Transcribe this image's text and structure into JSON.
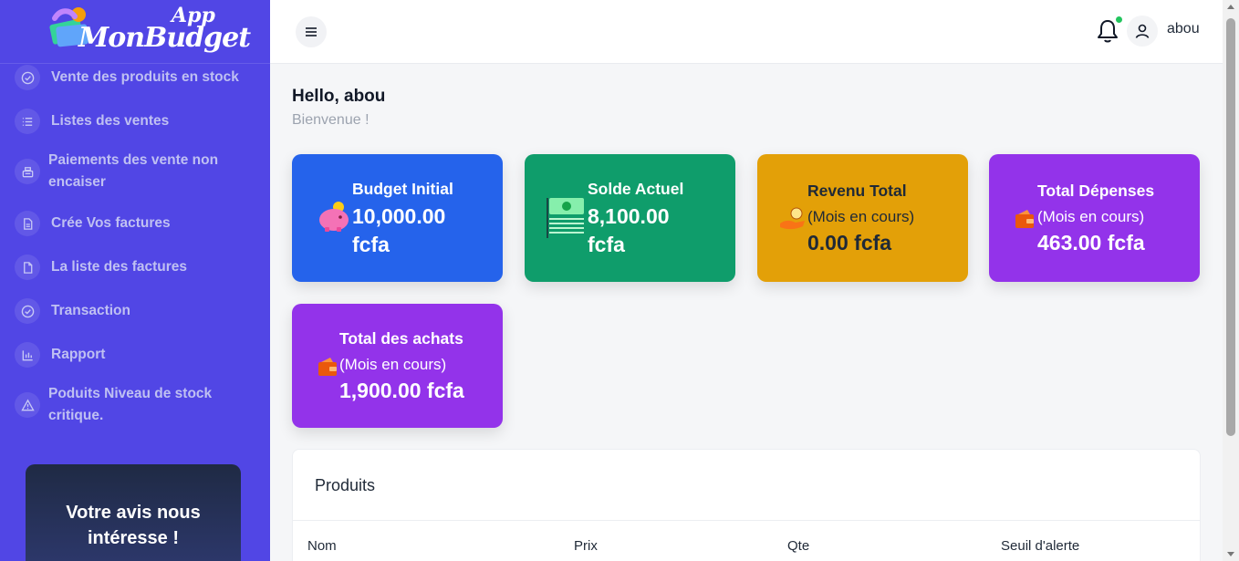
{
  "sidebar": {
    "logo": {
      "app": "App",
      "name": "MonBudget"
    },
    "items": [
      {
        "label": "Vente des produits en stock",
        "icon": "check-circle-icon"
      },
      {
        "label": "Listes des ventes",
        "icon": "list-icon"
      },
      {
        "label": "Paiements des vente non encaiser",
        "icon": "cash-register-icon"
      },
      {
        "label": "Crée Vos factures",
        "icon": "file-text-icon"
      },
      {
        "label": "La liste des factures",
        "icon": "file-icon"
      },
      {
        "label": "Transaction",
        "icon": "check-circle-icon"
      },
      {
        "label": "Rapport",
        "icon": "bar-chart-icon"
      },
      {
        "label": "Poduits Niveau de stock critique.",
        "icon": "warning-icon"
      }
    ],
    "feedback": {
      "line1": "Votre avis nous",
      "line2": "intéresse !"
    }
  },
  "header": {
    "user": "abou"
  },
  "main": {
    "greeting": "Hello, abou",
    "welcome": "Bienvenue !",
    "cards": [
      {
        "title": "Budget Initial",
        "value_line1": "10,000.00",
        "value_line2": "fcfa",
        "icon": "piggy-bank-icon",
        "color": "#2563eb"
      },
      {
        "title": "Solde Actuel",
        "value_line1": "8,100.00",
        "value_line2": "fcfa",
        "icon": "banknotes-icon",
        "color": "#0f9d6b"
      },
      {
        "title": "Revenu Total",
        "subtitle": "(Mois en cours)",
        "value": "0.00 fcfa",
        "icon": "hand-coin-icon",
        "color": "#e3a008"
      },
      {
        "title": "Total Dépenses",
        "subtitle": "(Mois en cours)",
        "value": "463.00 fcfa",
        "icon": "wallet-icon",
        "color": "#9333ea"
      },
      {
        "title": "Total des achats",
        "subtitle": "(Mois en cours)",
        "value": "1,900.00 fcfa",
        "icon": "wallet-icon",
        "color": "#9333ea"
      }
    ],
    "products": {
      "title": "Produits",
      "columns": [
        "Nom",
        "Prix",
        "Qte",
        "Seuil d'alerte"
      ]
    }
  }
}
